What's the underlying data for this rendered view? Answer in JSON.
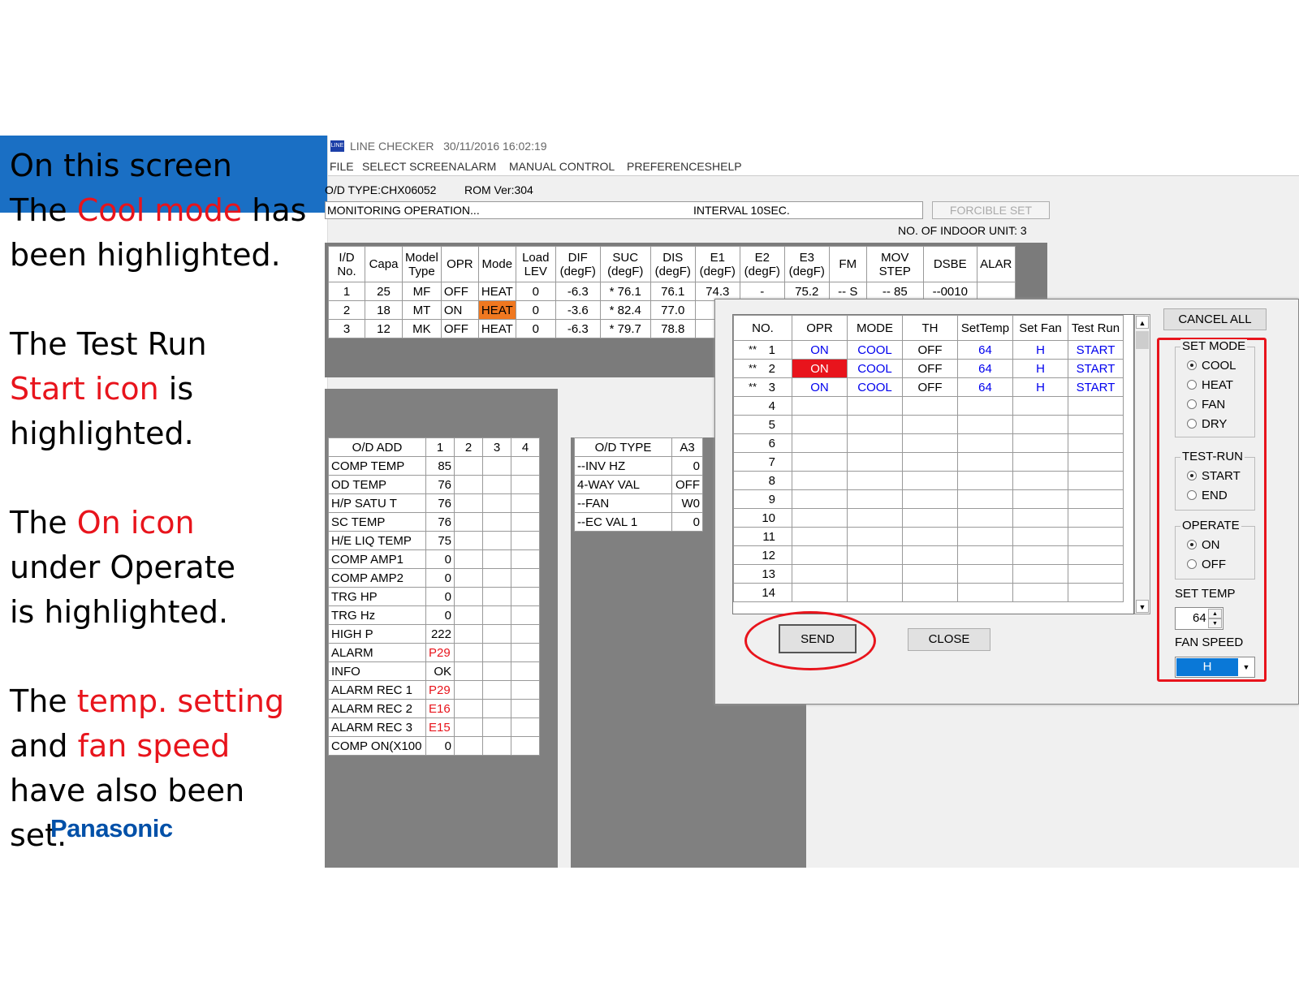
{
  "annotation": {
    "lines": [
      [
        {
          "t": "On this screen",
          "red": false
        }
      ],
      [
        {
          "t": "The ",
          "red": false
        },
        {
          "t": "Cool mode",
          "red": true
        },
        {
          "t": " has",
          "red": false
        }
      ],
      [
        {
          "t": "been highlighted.",
          "red": false
        }
      ],
      [
        {
          "t": "The Test Run",
          "red": false
        }
      ],
      [
        {
          "t": "Start icon",
          "red": true
        },
        {
          "t": " is",
          "red": false
        }
      ],
      [
        {
          "t": "highlighted.",
          "red": false
        }
      ],
      [
        {
          "t": "The ",
          "red": false
        },
        {
          "t": "On icon",
          "red": true
        }
      ],
      [
        {
          "t": "under Operate",
          "red": false
        }
      ],
      [
        {
          "t": "is highlighted.",
          "red": false
        }
      ],
      [
        {
          "t": "The ",
          "red": false
        },
        {
          "t": "temp. setting",
          "red": true
        }
      ],
      [
        {
          "t": "and ",
          "red": false
        },
        {
          "t": "fan speed",
          "red": true
        }
      ],
      [
        {
          "t": "have also been",
          "red": false
        }
      ],
      [
        {
          "t": "set.",
          "red": false
        }
      ]
    ],
    "logo": "Panasonic",
    "accent_color": "#e8141c",
    "banner_color": "#1a6fc4"
  },
  "app": {
    "icon_label": "LINE",
    "title": "LINE CHECKER   30/11/2016 16:02:19",
    "menu": [
      "FILE",
      "SELECT SCREEN",
      "ALARM",
      "MANUAL CONTROL",
      "PREFERENCES",
      "HELP"
    ],
    "od_type": "O/D TYPE:CHX06052",
    "rom_ver": "ROM Ver:304",
    "status": "MONITORING OPERATION...",
    "interval": "INTERVAL 10SEC.",
    "forcible_set": "FORCIBLE SET",
    "indoor_count": "NO. OF INDOOR UNIT: 3"
  },
  "indoor_table": {
    "headers": [
      [
        "I/D",
        "No."
      ],
      [
        "Capa",
        ""
      ],
      [
        "Model",
        "Type"
      ],
      [
        "OPR",
        ""
      ],
      [
        "Mode",
        ""
      ],
      [
        "Load",
        "LEV"
      ],
      [
        "DIF",
        "(degF)"
      ],
      [
        "SUC",
        "(degF)"
      ],
      [
        "DIS",
        "(degF)"
      ],
      [
        "E1",
        "(degF)"
      ],
      [
        "E2",
        "(degF)"
      ],
      [
        "E3",
        "(degF)"
      ],
      [
        "FM",
        ""
      ],
      [
        "MOV",
        "STEP"
      ],
      [
        "DSBE",
        ""
      ],
      [
        "ALAR",
        ""
      ]
    ],
    "rows": [
      [
        "1",
        "25",
        "MF",
        "OFF",
        "HEAT",
        "0",
        "-6.3",
        "* 76.1",
        "76.1",
        "74.3",
        "-",
        "75.2",
        "-- S",
        "-- 85",
        "--0010",
        ""
      ],
      [
        "2",
        "18",
        "MT",
        "ON",
        "HEAT",
        "0",
        "-3.6",
        "* 82.4",
        "77.0",
        "",
        "",
        "",
        "",
        "",
        "",
        ""
      ],
      [
        "3",
        "12",
        "MK",
        "OFF",
        "HEAT",
        "0",
        "-6.3",
        "* 79.7",
        "78.8",
        "",
        "",
        "",
        "",
        "",
        "",
        ""
      ]
    ]
  },
  "od_add_table": {
    "headers": [
      "O/D ADD",
      "1",
      "2",
      "3",
      "4"
    ],
    "rows": [
      [
        "COMP TEMP",
        "85"
      ],
      [
        "OD TEMP",
        "76"
      ],
      [
        "H/P SATU T",
        "76"
      ],
      [
        "SC TEMP",
        "76"
      ],
      [
        "H/E LIQ TEMP",
        "75"
      ],
      [
        "COMP AMP1",
        "0"
      ],
      [
        "COMP AMP2",
        "0"
      ],
      [
        "TRG HP",
        "0"
      ],
      [
        "TRG Hz",
        "0"
      ],
      [
        "HIGH P",
        "222"
      ],
      [
        "ALARM",
        "P29"
      ],
      [
        "INFO",
        "OK"
      ],
      [
        "ALARM REC 1",
        "P29"
      ],
      [
        "ALARM REC 2",
        "E16"
      ],
      [
        "ALARM REC 3",
        "E15"
      ],
      [
        "COMP ON(X100",
        "0"
      ]
    ]
  },
  "od_type_table": {
    "headers": [
      "O/D TYPE",
      "A3"
    ],
    "rows": [
      [
        "--INV HZ",
        "0"
      ],
      [
        "4-WAY VAL",
        "OFF"
      ],
      [
        "--FAN",
        "W0"
      ],
      [
        "--EC VAL 1",
        "0"
      ]
    ]
  },
  "dialog": {
    "headers": [
      "NO.",
      "OPR",
      "MODE",
      "TH",
      "SetTemp",
      "Set Fan",
      "Test Run"
    ],
    "rows": [
      [
        "**",
        "1",
        "ON",
        "COOL",
        "OFF",
        "64",
        "H",
        "START"
      ],
      [
        "**",
        "2",
        "ON",
        "COOL",
        "OFF",
        "64",
        "H",
        "START"
      ],
      [
        "**",
        "3",
        "ON",
        "COOL",
        "OFF",
        "64",
        "H",
        "START"
      ],
      [
        "",
        "4",
        "",
        "",
        "",
        "",
        "",
        ""
      ],
      [
        "",
        "5",
        "",
        "",
        "",
        "",
        "",
        ""
      ],
      [
        "",
        "6",
        "",
        "",
        "",
        "",
        "",
        ""
      ],
      [
        "",
        "7",
        "",
        "",
        "",
        "",
        "",
        ""
      ],
      [
        "",
        "8",
        "",
        "",
        "",
        "",
        "",
        ""
      ],
      [
        "",
        "9",
        "",
        "",
        "",
        "",
        "",
        ""
      ],
      [
        "",
        "10",
        "",
        "",
        "",
        "",
        "",
        ""
      ],
      [
        "",
        "11",
        "",
        "",
        "",
        "",
        "",
        ""
      ],
      [
        "",
        "12",
        "",
        "",
        "",
        "",
        "",
        ""
      ],
      [
        "",
        "13",
        "",
        "",
        "",
        "",
        "",
        ""
      ],
      [
        "",
        "14",
        "",
        "",
        "",
        "",
        "",
        ""
      ]
    ],
    "cancel_all": "CANCEL ALL",
    "send": "SEND",
    "close": "CLOSE",
    "set_mode": {
      "caption": "SET MODE",
      "options": [
        "COOL",
        "HEAT",
        "FAN",
        "DRY"
      ],
      "selected": "COOL"
    },
    "test_run": {
      "caption": "TEST-RUN",
      "options": [
        "START",
        "END"
      ],
      "selected": "START"
    },
    "operate": {
      "caption": "OPERATE",
      "options": [
        "ON",
        "OFF"
      ],
      "selected": "ON"
    },
    "set_temp_label": "SET TEMP",
    "set_temp_value": "64",
    "fan_speed_label": "FAN SPEED",
    "fan_speed_value": "H"
  }
}
